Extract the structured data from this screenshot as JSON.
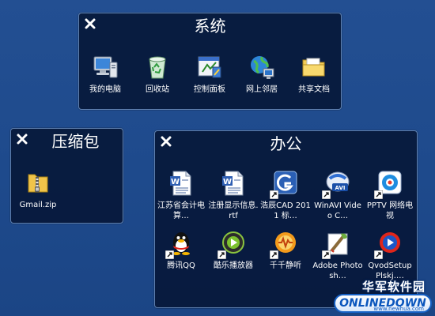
{
  "panels": {
    "system": {
      "title": "系统",
      "icons": [
        {
          "label": "我的电脑",
          "icon": "my-computer-icon"
        },
        {
          "label": "回收站",
          "icon": "recycle-bin-icon"
        },
        {
          "label": "控制面板",
          "icon": "control-panel-icon"
        },
        {
          "label": "网上邻居",
          "icon": "network-places-icon"
        },
        {
          "label": "共享文档",
          "icon": "shared-documents-folder-icon"
        }
      ]
    },
    "archive": {
      "title": "压缩包",
      "icons": [
        {
          "label": "Gmail.zip",
          "icon": "zip-archive-icon"
        }
      ]
    },
    "office": {
      "title": "办公",
      "icons": [
        {
          "label": "江苏省会计电算…",
          "icon": "word-document-icon"
        },
        {
          "label": "注册显示信息.rtf",
          "icon": "rtf-document-icon"
        },
        {
          "label": "浩辰CAD 2011 标…",
          "icon": "gstarcad-icon"
        },
        {
          "label": "WinAVI Video C…",
          "icon": "winavi-icon"
        },
        {
          "label": "PPTV 网络电视",
          "icon": "pptv-icon"
        },
        {
          "label": "腾讯QQ",
          "icon": "qq-penguin-icon"
        },
        {
          "label": "酷乐播放器",
          "icon": "kuyle-player-icon"
        },
        {
          "label": "千千静听",
          "icon": "ttplayer-icon"
        },
        {
          "label": "Adobe Photosh…",
          "icon": "photoshop-icon"
        },
        {
          "label": "QvodSetup Plskj.…",
          "icon": "qvod-icon"
        }
      ]
    }
  },
  "watermark": {
    "top_text": "华军软件园",
    "logo_text": "ONLINEDOWN",
    "url": "www.newhua.com"
  },
  "colors": {
    "desktop": "#1f4c8f",
    "panel": "#07183a",
    "panel_border": "#5e7fae",
    "text": "#ffffff"
  }
}
